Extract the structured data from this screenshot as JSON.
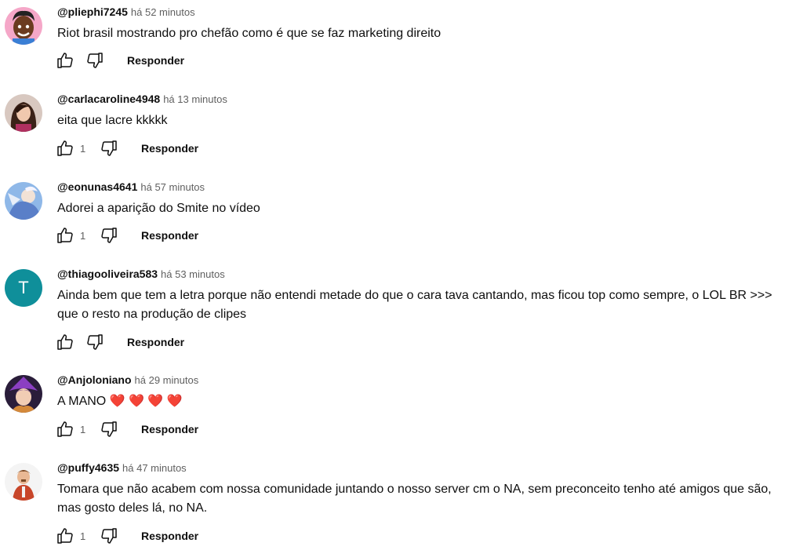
{
  "comments": [
    {
      "author": "@pliephi7245",
      "time": "há 52 minutos",
      "text": "Riot brasil mostrando pro chefão como é que se faz marketing direito",
      "likes": "",
      "reply": "Responder"
    },
    {
      "author": "@carlacaroline4948",
      "time": "há 13 minutos",
      "text": "eita que lacre kkkkk",
      "likes": "1",
      "reply": "Responder"
    },
    {
      "author": "@eonunas4641",
      "time": "há 57 minutos",
      "text": "Adorei a aparição do Smite no vídeo",
      "likes": "1",
      "reply": "Responder"
    },
    {
      "author": "@thiagooliveira583",
      "time": "há 53 minutos",
      "text": "Ainda bem que tem a letra porque não entendi metade do que o cara tava cantando, mas ficou top como sempre, o LOL BR >>> que o resto na produção de clipes",
      "likes": "",
      "reply": "Responder",
      "avatar_letter": "T"
    },
    {
      "author": "@Anjoloniano",
      "time": "há 29 minutos",
      "text": "A MANO ❤️ ❤️ ❤️ ❤️",
      "likes": "1",
      "reply": "Responder"
    },
    {
      "author": "@puffy4635",
      "time": "há 47 minutos",
      "text": "Tomara que não acabem com nossa comunidade juntando o nosso server cm o NA, sem preconceito tenho até amigos que são, mas gosto deles lá, no NA.",
      "likes": "1",
      "reply": "Responder"
    }
  ],
  "icons": {
    "like": "thumbs-up-icon",
    "dislike": "thumbs-down-icon"
  },
  "colors": {
    "letter_avatar": "#0f8f9a",
    "secondary_text": "#606060"
  }
}
